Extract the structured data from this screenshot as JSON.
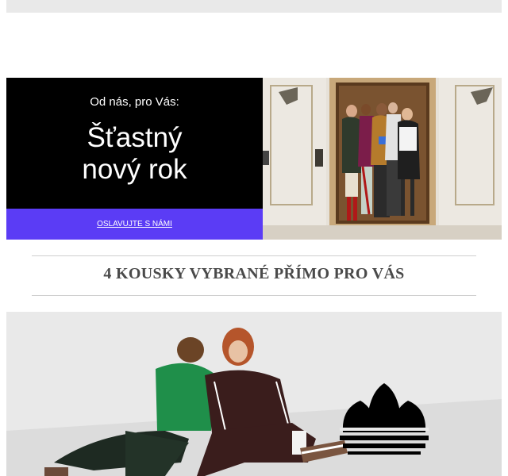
{
  "hero": {
    "subtitle": "Od nás, pro Vás:",
    "title_line1": "Šťastný",
    "title_line2": "nový rok",
    "cta_label": "OSLAVUJTE S NÁMI",
    "cta_color": "#5b3cf5"
  },
  "section": {
    "title": "4 KOUSKY VYBRANÉ PŘÍMO PRO VÁS"
  },
  "icons": {
    "brand_logo": "adidas-trefoil-icon"
  }
}
